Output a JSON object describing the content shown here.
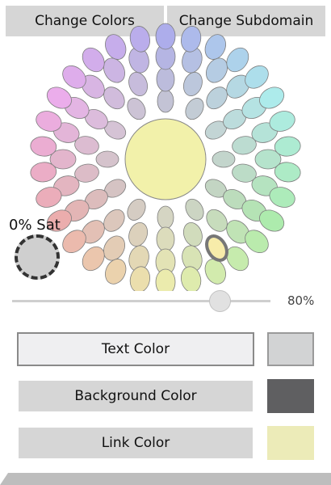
{
  "tabs": {
    "change_colors": "Change Colors",
    "change_subdomain": "Change Subdomain"
  },
  "saturation": {
    "label": "0% Sat",
    "swatch_color": "#cfcfcf"
  },
  "lightness_slider": {
    "value": 0.8,
    "value_label": "80%"
  },
  "color_targets": [
    {
      "label": "Text Color",
      "color": "#d2d3d4",
      "active": true
    },
    {
      "label": "Background Color",
      "color": "#5f5f61",
      "active": false
    },
    {
      "label": "Link Color",
      "color": "#ecebb8",
      "active": false
    }
  ],
  "wheel": {
    "center_color": "#f2f1aa",
    "selected_color": "#f7ecaa",
    "rings": [
      {
        "count": 12,
        "saturation": 0.25
      },
      {
        "count": 18,
        "saturation": 0.45
      },
      {
        "count": 24,
        "saturation": 0.65
      },
      {
        "count": 30,
        "saturation": 0.85
      }
    ]
  },
  "colors": {
    "tab_bg": "#d6d6d6",
    "button_bg": "#d6d6d6",
    "active_button_bg": "#efeff1",
    "selected_ring": "#777777"
  }
}
